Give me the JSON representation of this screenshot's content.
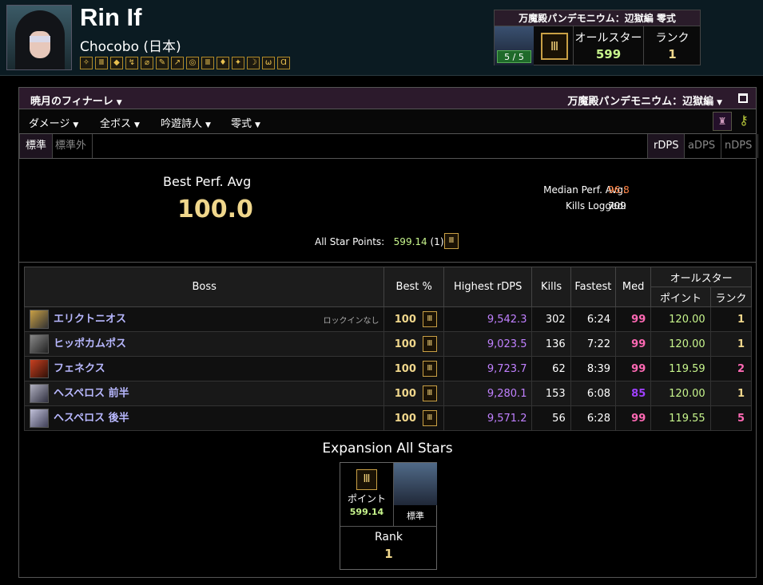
{
  "header": {
    "name": "Rin If",
    "server": "Chocobo (日本)",
    "job_icons": [
      "paladin",
      "warrior",
      "dark-knight",
      "gunbreaker",
      "white-mage",
      "scholar",
      "astrologian",
      "sage",
      "monk",
      "dragoon",
      "ninja",
      "samurai",
      "reaper",
      "bard"
    ],
    "zone": {
      "title": "万魔殿パンデモニウム：辺獄編 零式",
      "progress": "5 / 5",
      "allstar_label": "オールスター",
      "allstar_value": "599",
      "rank_label": "ランク",
      "rank_value": "1"
    }
  },
  "panel": {
    "class_selector": "暁月のフィナーレ",
    "zone_selector": "万魔殿パンデモニウム：辺獄編",
    "filters": [
      "ダメージ",
      "全ボス",
      "吟遊詩人",
      "零式"
    ],
    "tabs_left": [
      "標準",
      "標準外"
    ],
    "tabs_right": [
      "rDPS",
      "aDPS",
      "nDPS"
    ]
  },
  "summary": {
    "best_perf_label": "Best Perf. Avg",
    "best_perf_value": "100.0",
    "median_label": "Median Perf. Avg:",
    "median_value": "96.8",
    "kills_label": "Kills Logged:",
    "kills_value": "709",
    "allstar_label": "All Star Points:",
    "allstar_points": "599.14",
    "allstar_rank": "(1)"
  },
  "table": {
    "headers": {
      "boss": "Boss",
      "best": "Best %",
      "highest": "Highest rDPS",
      "kills": "Kills",
      "fastest": "Fastest",
      "med": "Med",
      "allstar": "オールスター",
      "points": "ポイント",
      "rank": "ランク"
    },
    "rows": [
      {
        "boss": "エリクトニオス",
        "note": "ロックインなし",
        "best": "100",
        "rdps": "9,542.3",
        "kills": "302",
        "fastest": "6:24",
        "med": "99",
        "points": "120.00",
        "rank": "1"
      },
      {
        "boss": "ヒッポカムポス",
        "note": "",
        "best": "100",
        "rdps": "9,023.5",
        "kills": "136",
        "fastest": "7:22",
        "med": "99",
        "points": "120.00",
        "rank": "1"
      },
      {
        "boss": "フェネクス",
        "note": "",
        "best": "100",
        "rdps": "9,723.7",
        "kills": "62",
        "fastest": "8:39",
        "med": "99",
        "points": "119.59",
        "rank": "2"
      },
      {
        "boss": "ヘスペロス 前半",
        "note": "",
        "best": "100",
        "rdps": "9,280.1",
        "kills": "153",
        "fastest": "6:08",
        "med": "85",
        "points": "120.00",
        "rank": "1"
      },
      {
        "boss": "ヘスペロス 後半",
        "note": "",
        "best": "100",
        "rdps": "9,571.2",
        "kills": "56",
        "fastest": "6:28",
        "med": "99",
        "points": "119.55",
        "rank": "5"
      }
    ]
  },
  "expansion": {
    "title": "Expansion All Stars",
    "points_label": "ポイント",
    "points_value": "599.14",
    "standard_label": "標準",
    "rank_label": "Rank",
    "rank_value": "1"
  },
  "colors": {
    "gold": "#f0d78c",
    "green": "#c7f58c",
    "pink": "#ff69b4",
    "purple": "#a040ff",
    "rdps": "#c080ff",
    "median_orange": "#ff8040"
  }
}
